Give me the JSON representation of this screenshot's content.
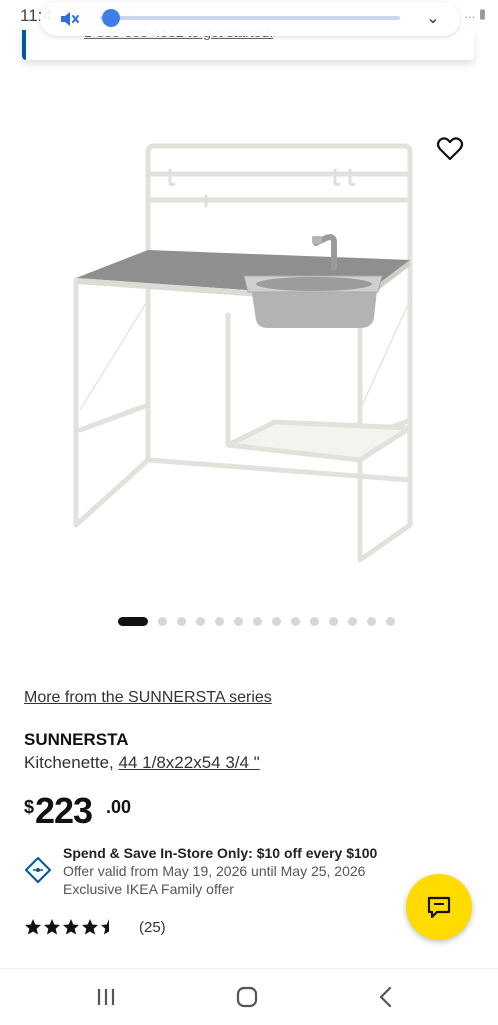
{
  "status_bar": {
    "time": "11:4",
    "right_text": "... ▮"
  },
  "volume_panel": {
    "mute_icon": "volume-mute-icon",
    "expand_icon": "chevron-down-icon",
    "level": 0.02
  },
  "banner": {
    "text": "1-888-888-4532 to get started."
  },
  "product_image": {
    "wishlist_icon": "heart-outline-icon"
  },
  "carousel": {
    "total": 14,
    "active_index": 0
  },
  "product": {
    "series_link": "More from the SUNNERSTA series",
    "name": "SUNNERSTA",
    "desc_prefix": "Kitchenette, ",
    "size": "44 1/8x22x54 3/4 \"",
    "price_currency": "$",
    "price_main": "223",
    "price_cents": ".00"
  },
  "offer": {
    "icon": "tag-offer-icon",
    "title": "Spend & Save In-Store Only: $10 off every $100",
    "valid": "Offer valid from May 19, 2026 until May 25, 2026",
    "family": "Exclusive IKEA Family offer"
  },
  "rating": {
    "stars": 4.5,
    "max": 5,
    "count": "(25)"
  },
  "chat": {
    "icon": "chat-icon"
  },
  "nav": {
    "recent_icon": "recent-apps-icon",
    "home_icon": "home-icon",
    "back_icon": "back-icon"
  },
  "colors": {
    "accent_blue": "#0058a3",
    "chat_yellow": "#ffdb00",
    "volume_blue": "#3f7ee8"
  }
}
